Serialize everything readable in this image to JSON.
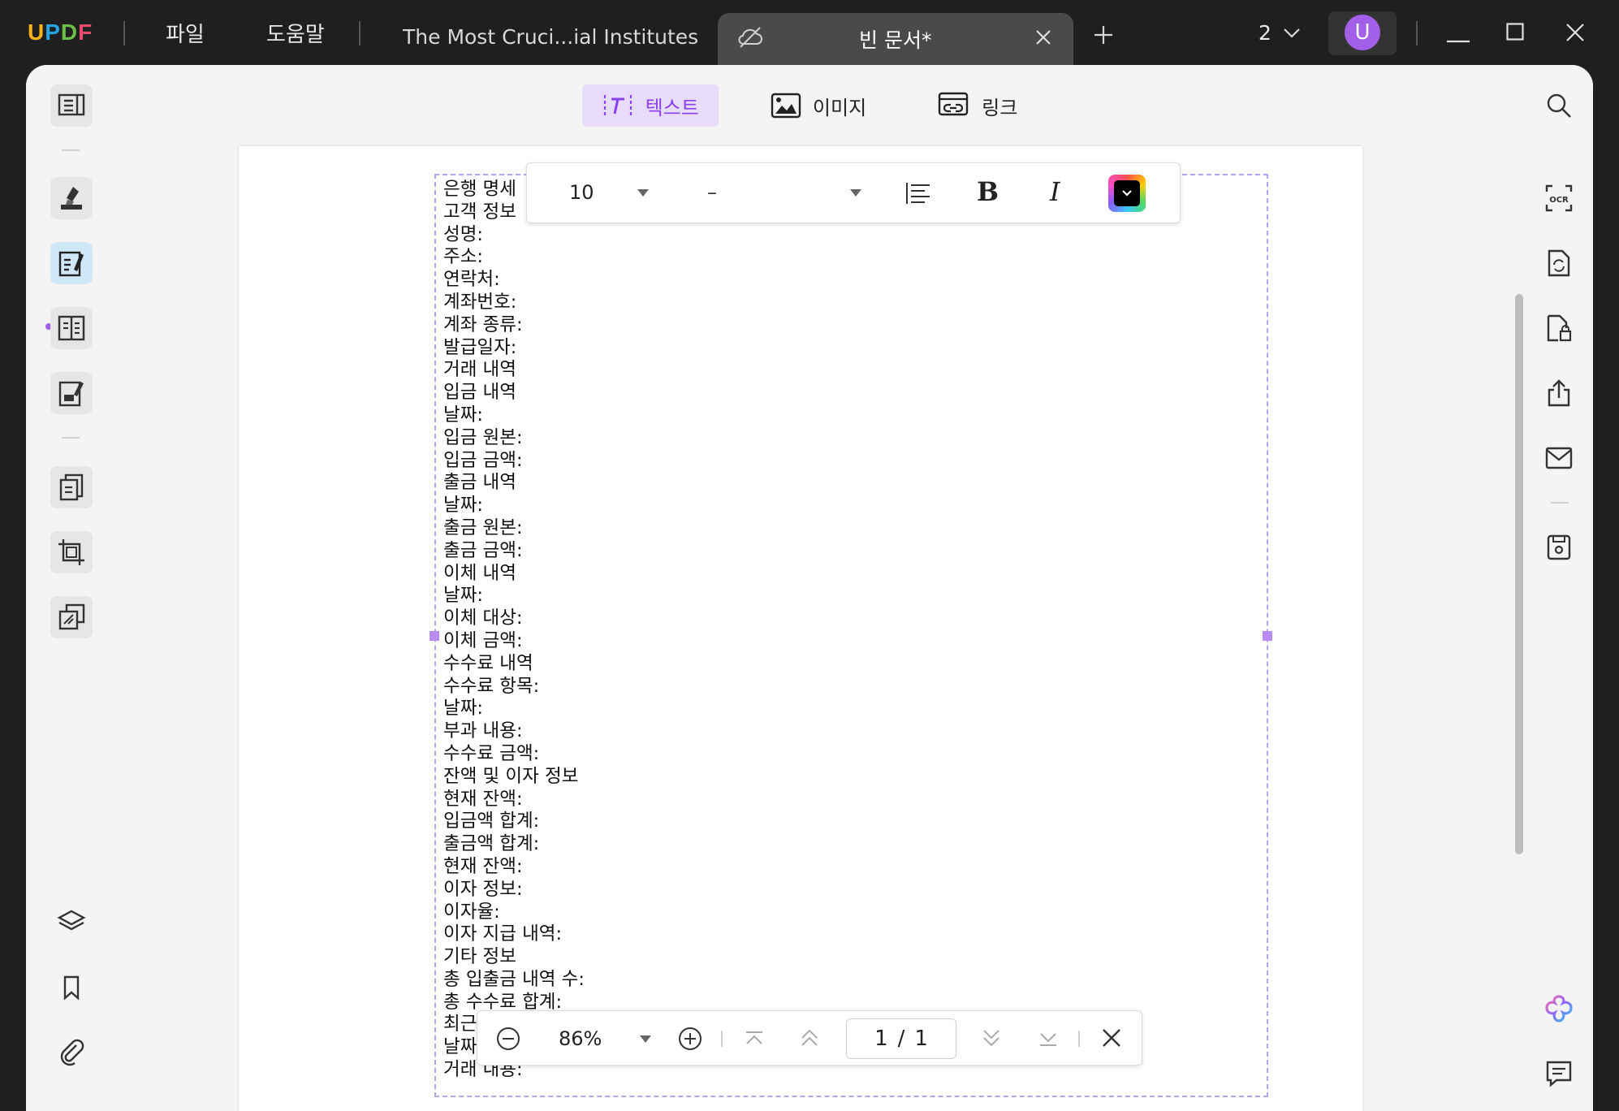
{
  "app": {
    "logo": "UPDF",
    "menu": [
      "파일",
      "도움말"
    ],
    "tabs": [
      {
        "label": "The Most Cruci...ial Institutes",
        "active": false
      },
      {
        "label": "빈 문서*",
        "active": true
      }
    ],
    "page_count_label": "2",
    "avatar_initial": "U",
    "accent_color": "#a25fe8"
  },
  "left_sidebar": {
    "items": [
      "reader-icon",
      "comment-icon",
      "edit-pdf-icon",
      "organize-icon",
      "fill-sign-icon",
      "pages-icon",
      "crop-icon",
      "batch-icon",
      "layers-icon",
      "bookmark-icon",
      "attachment-icon"
    ]
  },
  "right_sidebar": {
    "items": [
      "search-icon",
      "ocr-icon",
      "convert-icon",
      "protect-icon",
      "share-icon",
      "email-icon",
      "save-icon",
      "ai-icon",
      "comment-panel-icon"
    ]
  },
  "edit_toolbar": {
    "text": "텍스트",
    "image": "이미지",
    "link": "링크"
  },
  "format_bar": {
    "font_size": "10",
    "font_family": "–",
    "bold": "B",
    "italic": "I",
    "color": "#000000"
  },
  "document": {
    "lines": [
      "은행 명세",
      "고객 정보",
      "성명:",
      "주소:",
      "연락처:",
      "계좌번호:",
      "계좌 종류:",
      "발급일자:",
      "거래 내역",
      "입금 내역",
      "날짜:",
      "입금 원본:",
      "입금 금액:",
      "출금 내역",
      "날짜:",
      "출금 원본:",
      "출금 금액:",
      "이체 내역",
      "날짜:",
      "이체 대상:",
      "이체 금액:",
      "수수료 내역",
      "수수료 항목:",
      "날짜:",
      "부과 내용:",
      "수수료 금액:",
      "잔액 및 이자 정보",
      "현재 잔액:",
      "입금액 합계:",
      "출금액 합계:",
      "현재 잔액:",
      "이자 정보:",
      "이자율:",
      "이자 지급 내역:",
      "기타 정보",
      "총 입출금 내역 수:",
      "총 수수료 합계:",
      "최근",
      "날짜",
      "거래 내용:"
    ]
  },
  "zoom_bar": {
    "zoom": "86%",
    "current_page": "1",
    "page_sep": "/",
    "total_pages": "1"
  }
}
